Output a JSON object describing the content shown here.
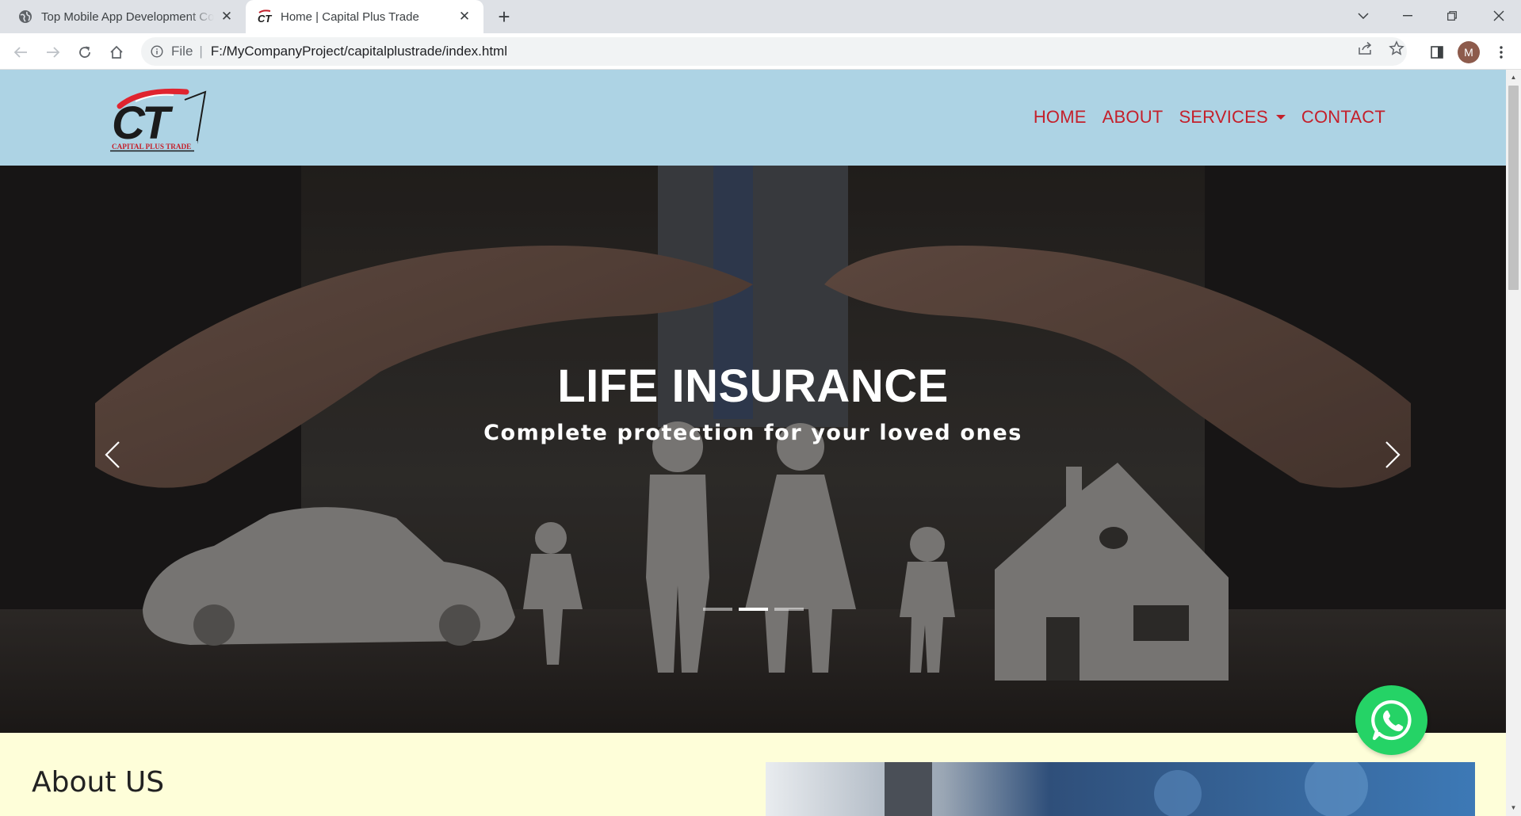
{
  "browser": {
    "tabs": [
      {
        "title": "Top Mobile App Development Co",
        "active": false,
        "favicon": "globe-icon"
      },
      {
        "title": "Home | Capital Plus Trade",
        "active": true,
        "favicon": "ct-logo-icon"
      }
    ],
    "address": {
      "scheme": "File",
      "path": "F:/MyCompanyProject/capitalplustrade/index.html"
    },
    "profile_initial": "M"
  },
  "site": {
    "logo_text": "CT",
    "logo_caption": "CAPITAL PLUS TRADE",
    "nav": [
      {
        "label": "HOME"
      },
      {
        "label": "ABOUT"
      },
      {
        "label": "SERVICES",
        "dropdown": true
      },
      {
        "label": "CONTACT"
      }
    ],
    "nav_color": "#c4202b",
    "header_bg": "#add3e4"
  },
  "hero": {
    "title": "LIFE INSURANCE",
    "subtitle": "Complete protection for your loved ones",
    "slides": 3,
    "active_slide": 2
  },
  "about": {
    "heading": "About US",
    "bg": "#fefed9"
  },
  "colors": {
    "whatsapp": "#25d366"
  }
}
